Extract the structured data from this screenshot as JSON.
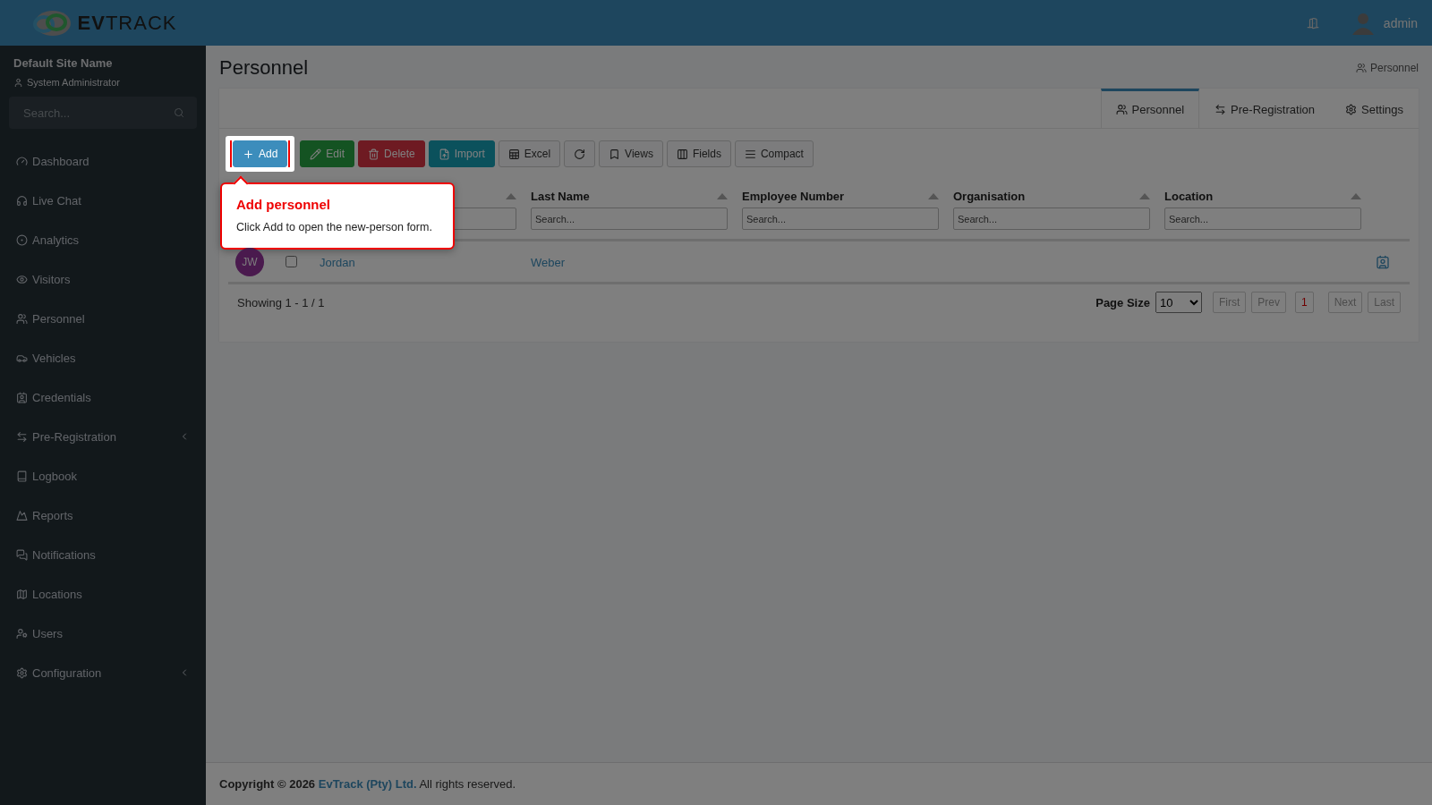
{
  "header": {
    "logo_bold": "EV",
    "logo_rest": "TRACK",
    "user": "admin"
  },
  "sidebar": {
    "site": "Default Site Name",
    "role": "System Administrator",
    "search": {
      "placeholder": "Search..."
    },
    "items": [
      {
        "label": "Dashboard",
        "submenu": false
      },
      {
        "label": "Live Chat",
        "submenu": false
      },
      {
        "label": "Analytics",
        "submenu": false
      },
      {
        "label": "Visitors",
        "submenu": false
      },
      {
        "label": "Personnel",
        "submenu": false
      },
      {
        "label": "Vehicles",
        "submenu": false
      },
      {
        "label": "Credentials",
        "submenu": false
      },
      {
        "label": "Pre-Registration",
        "submenu": true
      },
      {
        "label": "Logbook",
        "submenu": false
      },
      {
        "label": "Reports",
        "submenu": false
      },
      {
        "label": "Notifications",
        "submenu": false
      },
      {
        "label": "Locations",
        "submenu": false
      },
      {
        "label": "Users",
        "submenu": false
      },
      {
        "label": "Configuration",
        "submenu": true
      }
    ]
  },
  "page": {
    "title": "Personnel",
    "breadcrumb": "Personnel"
  },
  "tabs": [
    {
      "label": "Personnel",
      "selected": true
    },
    {
      "label": "Pre-Registration",
      "selected": false
    },
    {
      "label": "Settings",
      "selected": false
    }
  ],
  "toolbar": [
    {
      "kind": "add",
      "label": "Add"
    },
    {
      "kind": "edit",
      "label": "Edit"
    },
    {
      "kind": "delete",
      "label": "Delete"
    },
    {
      "kind": "import",
      "label": "Import"
    },
    {
      "kind": "excel",
      "label": "Excel"
    },
    {
      "kind": "refresh"
    },
    {
      "kind": "views",
      "label": "Views"
    },
    {
      "kind": "fields",
      "label": "Fields"
    },
    {
      "kind": "compact",
      "label": "Compact"
    }
  ],
  "tour": {
    "title": "Add personnel",
    "text": "Click Add to open the new-person form."
  },
  "table": {
    "columns": [
      {
        "kind": "covered"
      },
      {
        "kind": "text",
        "label": "Last Name",
        "placeholder": "Search..."
      },
      {
        "kind": "text",
        "label": "Employee Number",
        "placeholder": "Search..."
      },
      {
        "kind": "text",
        "label": "Organisation",
        "placeholder": "Search..."
      },
      {
        "kind": "text",
        "label": "Location",
        "placeholder": "Search..."
      }
    ],
    "rows": [
      {
        "initials": "JW",
        "color": "#4a1a4e",
        "checked": false,
        "first_name": "Jordan",
        "last_name": "Weber"
      }
    ]
  },
  "pager": {
    "showing": "Showing 1 - 1 / 1",
    "page_size_label": "Page Size",
    "page_size": "10",
    "before": [
      "First",
      "Prev"
    ],
    "pages": [
      {
        "label": "1",
        "selected": true
      }
    ],
    "after": [
      "Next",
      "Last"
    ]
  },
  "footer": {
    "copyright": "Copyright © 2026",
    "company": "EvTrack (Pty) Ltd.",
    "rest": "All rights reserved."
  }
}
